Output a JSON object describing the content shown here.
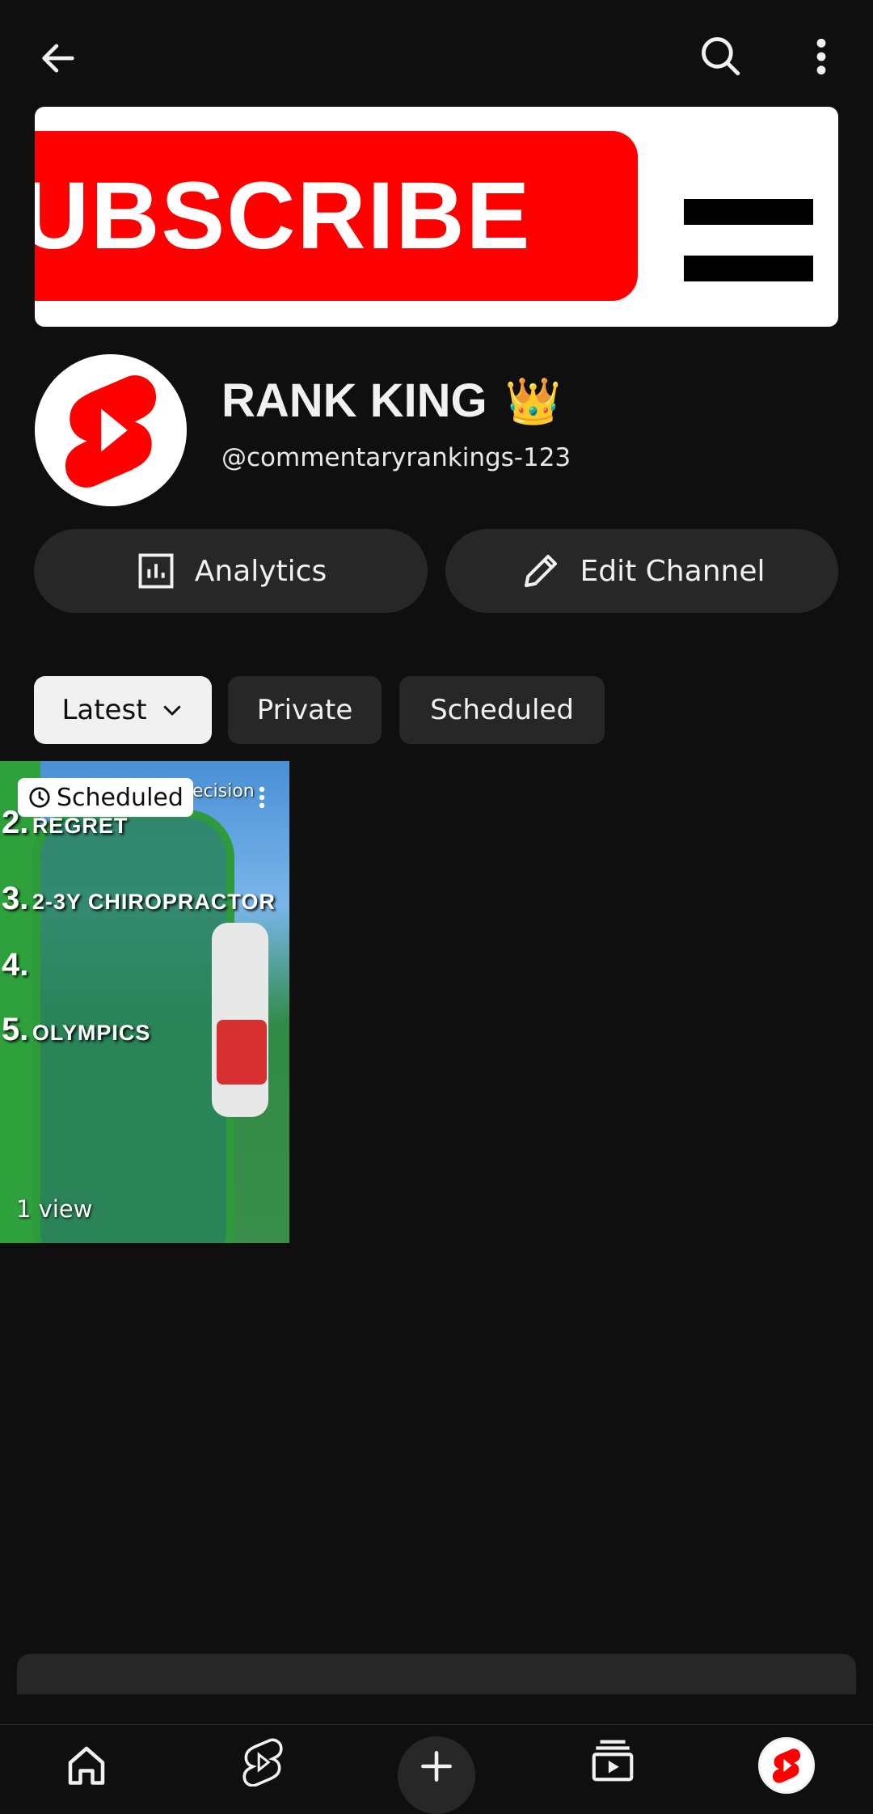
{
  "topbar": {
    "back_icon": "arrow-left-icon",
    "search_icon": "search-icon",
    "more_icon": "more-vertical-icon"
  },
  "banner": {
    "text": "UBSCRIBE"
  },
  "channel": {
    "name": "RANK KING",
    "emoji": "👑",
    "handle": "@commentaryrankings-123"
  },
  "actions": {
    "analytics_label": "Analytics",
    "edit_label": "Edit Channel"
  },
  "filters": {
    "latest": "Latest",
    "private": "Private",
    "scheduled": "Scheduled"
  },
  "video": {
    "badge": "Scheduled",
    "overlay_title": "ecision",
    "lines": [
      {
        "num": "2.",
        "text": "REGRET"
      },
      {
        "num": "3.",
        "text": "2-3Y CHIROPRACTOR"
      },
      {
        "num": "4.",
        "text": ""
      },
      {
        "num": "5.",
        "text": "OLYMPICS"
      }
    ],
    "views": "1 view"
  },
  "colors": {
    "background": "#0f0f0f",
    "surface": "#272727",
    "brand_red": "#ff0000"
  }
}
